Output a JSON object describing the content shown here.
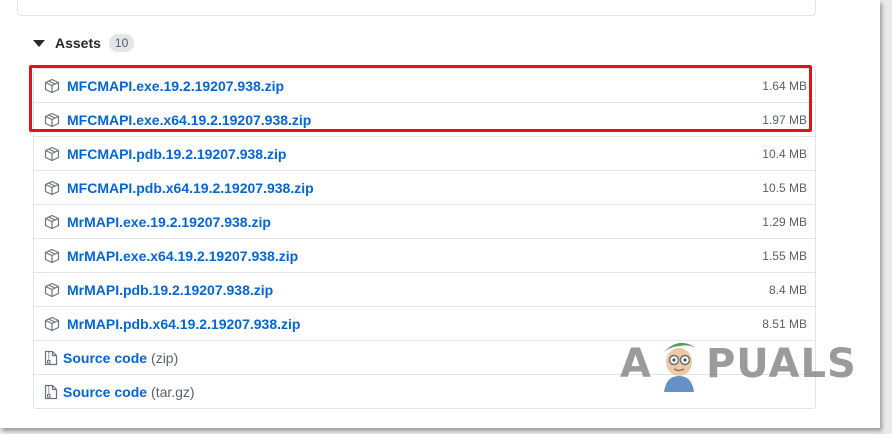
{
  "assets": {
    "title": "Assets",
    "count": "10",
    "items": [
      {
        "name": "MFCMAPI.exe.19.2.19207.938.zip",
        "size": "1.64 MB"
      },
      {
        "name": "MFCMAPI.exe.x64.19.2.19207.938.zip",
        "size": "1.97 MB"
      },
      {
        "name": "MFCMAPI.pdb.19.2.19207.938.zip",
        "size": "10.4 MB"
      },
      {
        "name": "MFCMAPI.pdb.x64.19.2.19207.938.zip",
        "size": "10.5 MB"
      },
      {
        "name": "MrMAPI.exe.19.2.19207.938.zip",
        "size": "1.29 MB"
      },
      {
        "name": "MrMAPI.exe.x64.19.2.19207.938.zip",
        "size": "1.55 MB"
      },
      {
        "name": "MrMAPI.pdb.19.2.19207.938.zip",
        "size": "8.4 MB"
      },
      {
        "name": "MrMAPI.pdb.x64.19.2.19207.938.zip",
        "size": "8.51 MB"
      }
    ],
    "source": [
      {
        "label": "Source code",
        "ext": "(zip)"
      },
      {
        "label": "Source code",
        "ext": "(tar.gz)"
      }
    ]
  },
  "watermark": {
    "brand_left": "A",
    "brand_right": "PUALS"
  },
  "colors": {
    "link": "#0366d6",
    "highlight": "#e0151b",
    "muted": "#586069"
  },
  "icons": {
    "package": "package-icon",
    "source": "file-zip-icon",
    "caret": "triangle-down-icon"
  }
}
